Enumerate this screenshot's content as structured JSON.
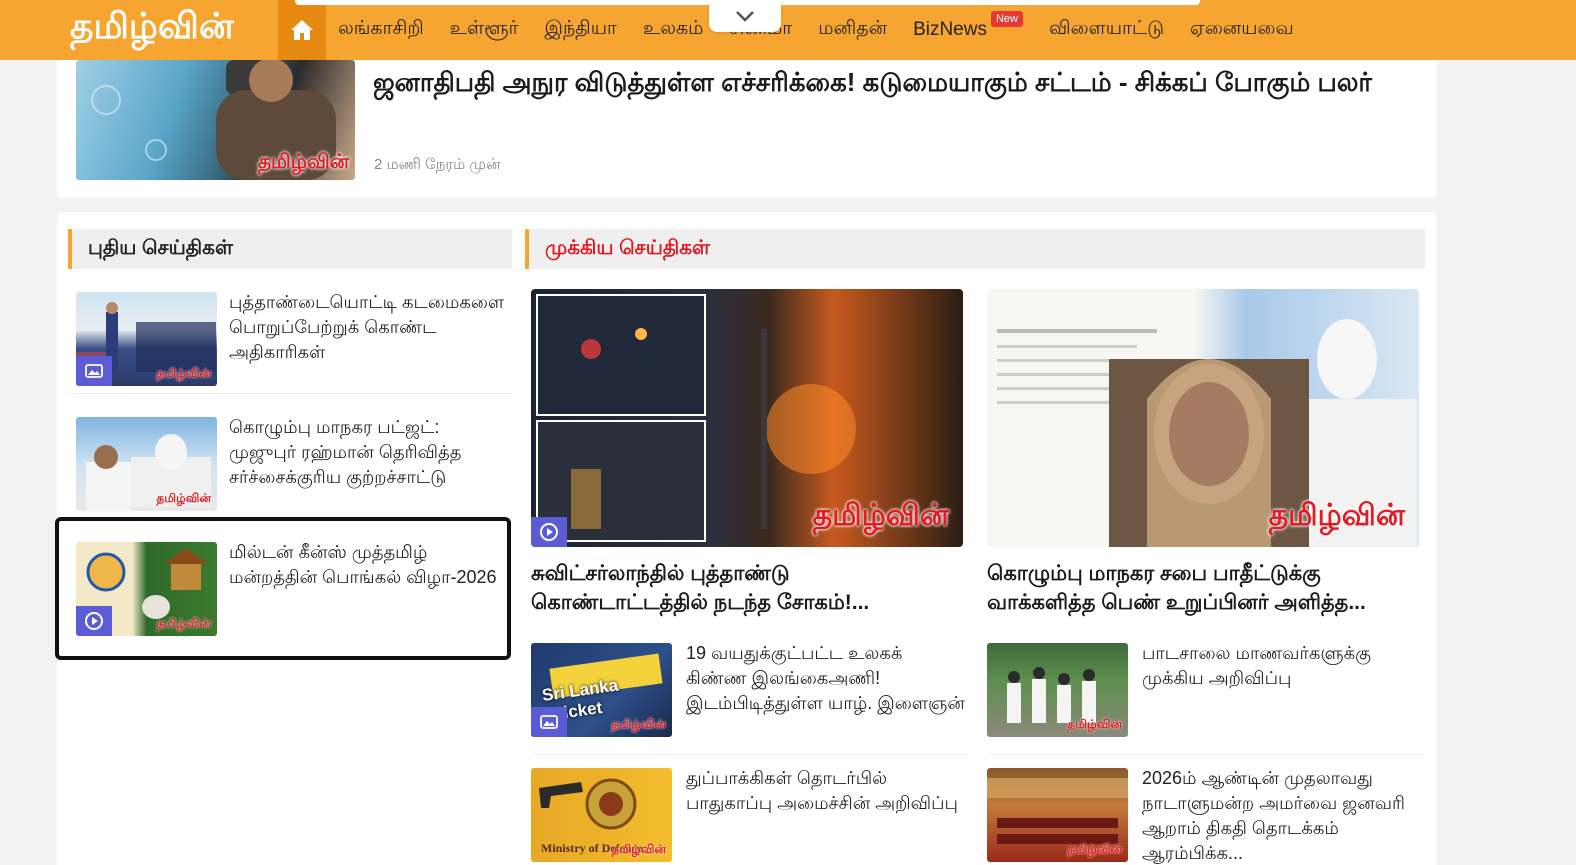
{
  "site": {
    "logo": "தமிழ்வின்"
  },
  "nav": {
    "items": [
      {
        "label": "லங்காசிறி"
      },
      {
        "label": "உள்ளூர்"
      },
      {
        "label": "இந்தியா"
      },
      {
        "label": "உலகம்"
      },
      {
        "label": "சினிமா"
      },
      {
        "label": "மனிதன்"
      },
      {
        "label": "BizNews",
        "badge": "New"
      },
      {
        "label": "விளையாட்டு"
      },
      {
        "label": "ஏனையவை"
      }
    ]
  },
  "featured": {
    "title": "ஜனாதிபதி அநுர விடுத்துள்ள எச்சரிக்கை! கடுமையாகும் சட்டம் - சிக்கப் போகும் பலர்",
    "time": "2 மணி நேரம் முன்",
    "watermark": "தமிழ்வின்"
  },
  "latest": {
    "heading": "புதிய செய்திகள்",
    "items": [
      {
        "title": "புத்தாண்டையொட்டி கடமைகளை பொறுப்பேற்றுக் கொண்ட அதிகாரிகள்",
        "media": "gallery",
        "watermark": "தமிழ்வின்"
      },
      {
        "title": "கொழும்பு மாநகர பட்ஜட்: முஜுபுர் ரஹ்மான் தெரிவித்த சர்ச்சைக்குரிய குற்றச்சாட்டு",
        "media": "none",
        "watermark": "தமிழ்வின்"
      },
      {
        "title": "மில்டன் கீன்ஸ் முத்தமிழ் மன்றத்தின் பொங்கல் விழா-2026",
        "media": "video",
        "watermark": "தமிழ்வின்"
      }
    ]
  },
  "top": {
    "heading": "முக்கிய செய்திகள்",
    "big": [
      {
        "title": "சுவிட்சர்லாந்தில் புத்தாண்டு கொண்டாட்டத்தில் நடந்த சோகம்!...",
        "media": "video",
        "watermark": "தமிழ்வின்"
      },
      {
        "title": "கொழும்பு மாநகர சபை பாதீட்டுக்கு வாக்களித்த பெண் உறுப்பினர் அளித்த...",
        "media": "none",
        "watermark": "தமிழ்வின்"
      }
    ],
    "small_left": [
      {
        "title": "19 வயதுக்குட்பட்ட உலகக் கிண்ண இலங்கைஅணி! இடம்பிடித்துள்ள யாழ். இளைஞன்",
        "media": "gallery",
        "watermark": "தமிழ்வின்",
        "image_text": "Sri Lanka Cricket"
      },
      {
        "title": "துப்பாக்கிகள் தொடர்பில் பாதுகாப்பு அமைச்சின் அறிவிப்பு",
        "media": "none",
        "watermark": "தமிழ்வின்",
        "image_text": "Ministry of Defence"
      }
    ],
    "small_right": [
      {
        "title": "பாடசாலை மாணவர்களுக்கு முக்கிய அறிவிப்பு",
        "media": "none",
        "watermark": "தமிழ்வின்"
      },
      {
        "title": "2026ம் ஆண்டின் முதலாவது நாடாளுமன்ற அமர்வை ஜனவரி ஆறாம் திகதி தொடக்கம் ஆரம்பிக்க...",
        "media": "none",
        "watermark": "தமிழ்வின்"
      }
    ]
  },
  "colors": {
    "brand": "#f7a531",
    "accent_red": "#e21c24",
    "media_badge": "#5b5bd6"
  }
}
